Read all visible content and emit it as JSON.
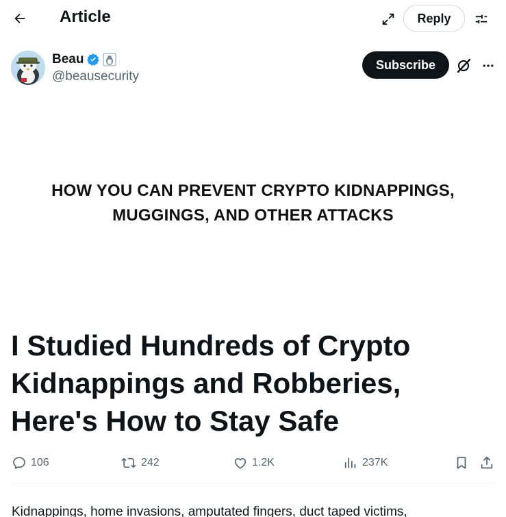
{
  "header": {
    "title": "Article",
    "reply_label": "Reply",
    "icons": {
      "back": "arrow-left-icon",
      "expand": "expand-icon",
      "settings": "sliders-icon"
    }
  },
  "author": {
    "name": "Beau",
    "handle": "@beausecurity",
    "verified_color": "#1d9bf0",
    "subscribe_label": "Subscribe",
    "icons": {
      "verified": "verified-badge-icon",
      "affiliate": "penguin-badge-icon",
      "grok": "grok-icon",
      "more": "more-icon"
    }
  },
  "banner": {
    "line1": "HOW YOU CAN PREVENT CRYPTO KIDNAPPINGS,",
    "line2": "MUGGINGS, AND OTHER ATTACKS"
  },
  "article": {
    "title_line1": "I Studied Hundreds of Crypto",
    "title_line2": "Kidnappings and Robberies,",
    "title_line3": "Here's How to Stay Safe",
    "body_first_line": "Kidnappings, home invasions, amputated fingers, duct taped victims,"
  },
  "stats": {
    "replies": "106",
    "reposts": "242",
    "likes": "1.2K",
    "views": "237K"
  },
  "colors": {
    "text": "#0f1419",
    "secondary": "#536471",
    "subscribe_bg": "#0f1419",
    "border": "#cfd9de"
  }
}
